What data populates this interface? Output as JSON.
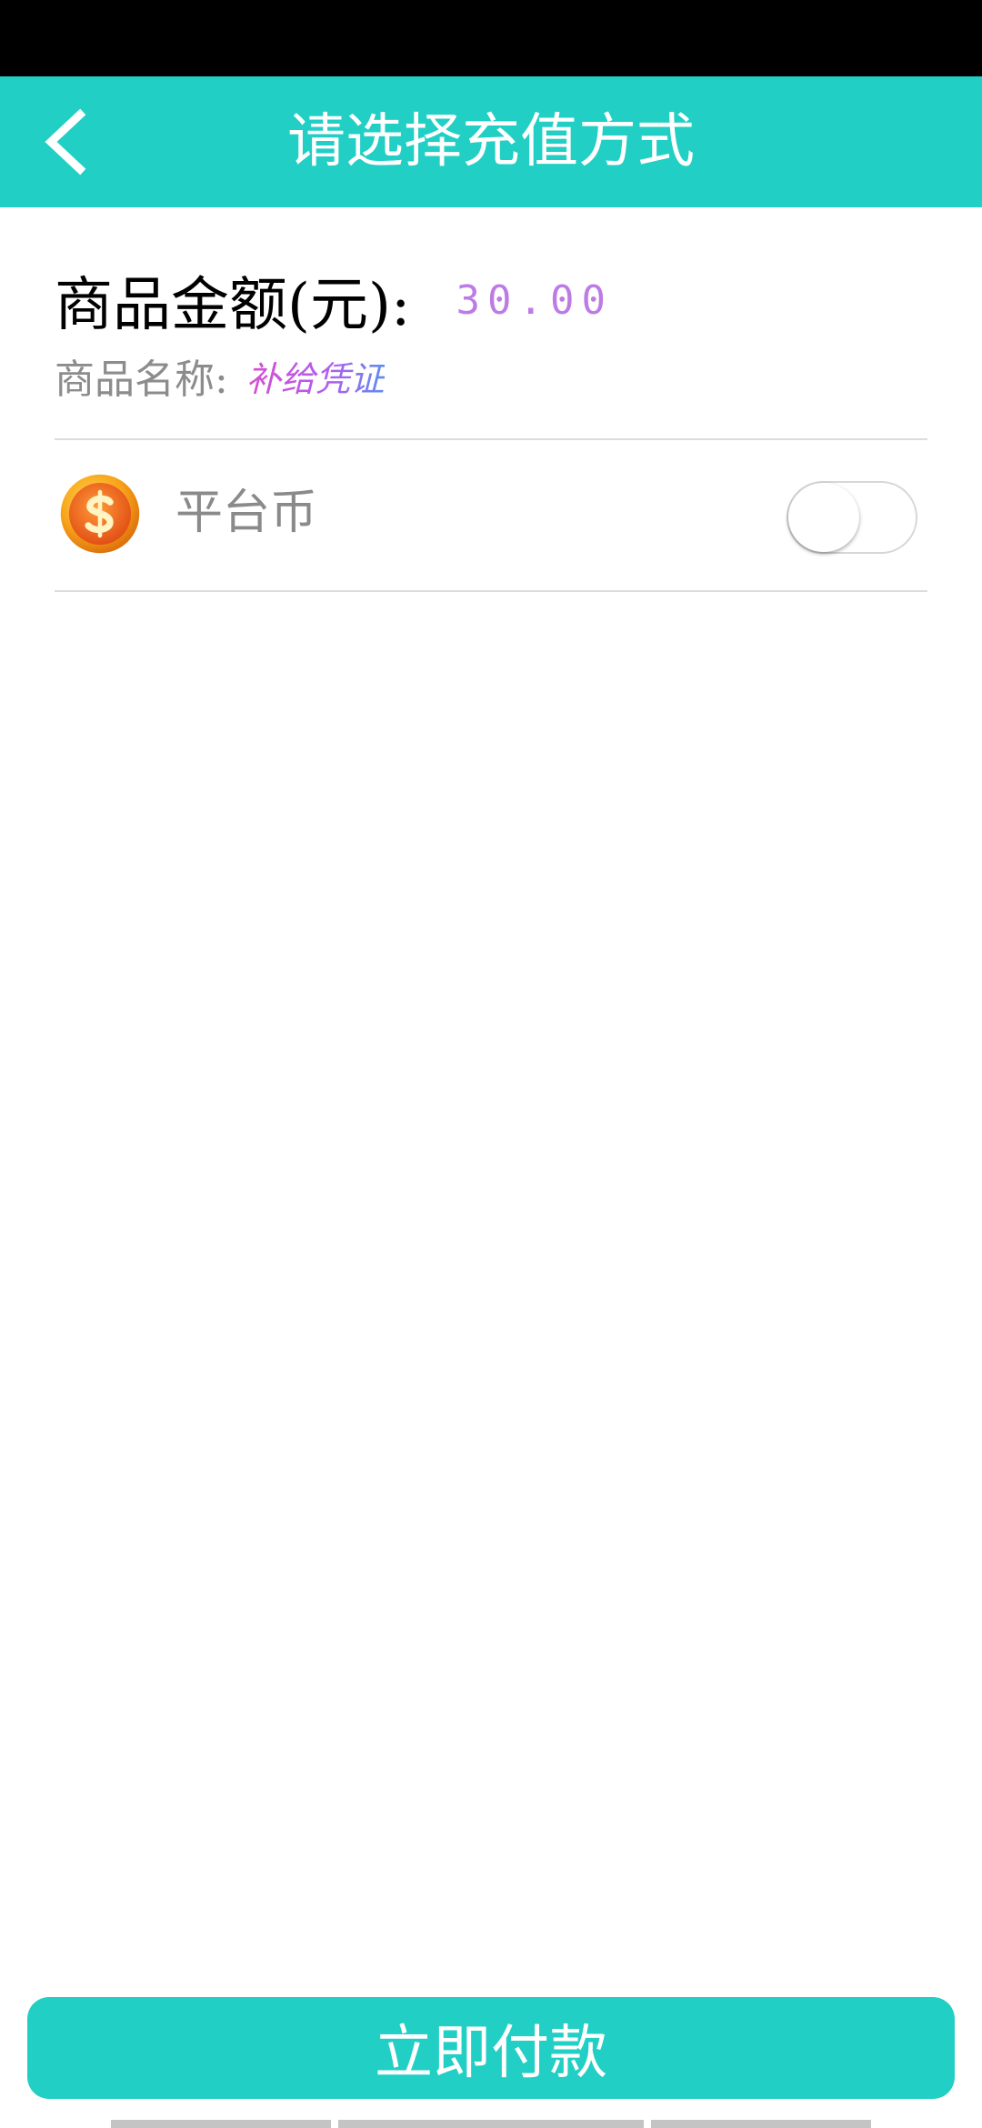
{
  "header": {
    "title": "请选择充值方式",
    "back_icon": "chevron-left-icon",
    "background_color": "#21cfc5"
  },
  "product": {
    "amount_label": "商品金额(元):",
    "amount_value": "30.00",
    "name_label": "商品名称:",
    "name_value": "补给凭证"
  },
  "payment_methods": [
    {
      "icon": "coin-icon",
      "label": "平台币",
      "enabled": false
    }
  ],
  "footer": {
    "pay_button_label": "立即付款"
  },
  "colors": {
    "accent": "#21cfc5",
    "amount_value": "#bd7be6",
    "muted_text": "#8c8c8c"
  }
}
